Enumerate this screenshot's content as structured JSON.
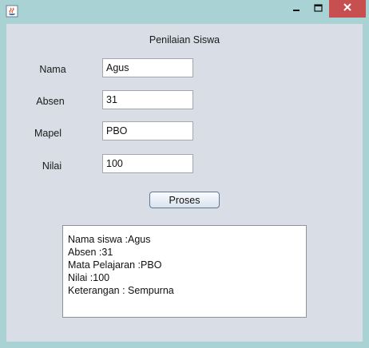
{
  "window": {
    "app_icon": "java-icon",
    "controls": {
      "minimize": "minimize-icon",
      "maximize": "maximize-icon",
      "close": "close-icon"
    },
    "close_color": "#c74f4f"
  },
  "form": {
    "title": "Penilaian Siswa",
    "fields": [
      {
        "label": "Nama",
        "value": "Agus"
      },
      {
        "label": "Absen",
        "value": "31"
      },
      {
        "label": "Mapel",
        "value": "PBO"
      },
      {
        "label": "Nilai",
        "value": "100"
      }
    ],
    "button_label": "Proses"
  },
  "output": {
    "lines": [
      "Nama siswa :Agus",
      "Absen :31",
      "Mata Pelajaran :PBO",
      "Nilai :100",
      "Keterangan : Sempurna"
    ]
  }
}
